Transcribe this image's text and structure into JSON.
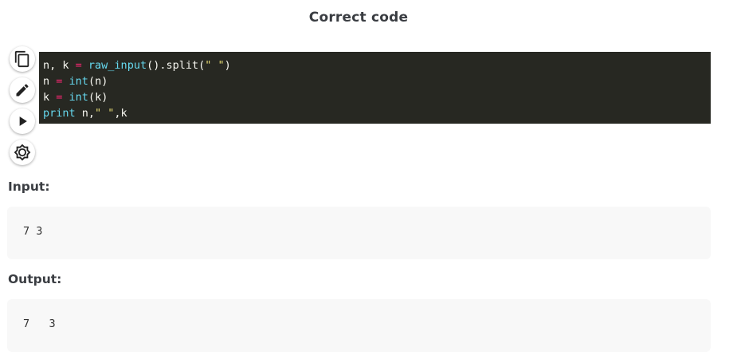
{
  "title": "Correct code",
  "toolbar": {
    "buttons": [
      {
        "name": "copy-button",
        "icon": "copy-icon"
      },
      {
        "name": "edit-button",
        "icon": "pencil-icon"
      },
      {
        "name": "run-button",
        "icon": "play-icon"
      },
      {
        "name": "settings-button",
        "icon": "gear-icon"
      }
    ]
  },
  "code": {
    "lines": [
      [
        {
          "t": "n, k ",
          "c": "plain"
        },
        {
          "t": "=",
          "c": "op"
        },
        {
          "t": " ",
          "c": "plain"
        },
        {
          "t": "raw_input",
          "c": "fn"
        },
        {
          "t": "().split(",
          "c": "plain"
        },
        {
          "t": "\" \"",
          "c": "str"
        },
        {
          "t": ")",
          "c": "plain"
        }
      ],
      [
        {
          "t": "n ",
          "c": "plain"
        },
        {
          "t": "=",
          "c": "op"
        },
        {
          "t": " ",
          "c": "plain"
        },
        {
          "t": "int",
          "c": "fn"
        },
        {
          "t": "(n)",
          "c": "plain"
        }
      ],
      [
        {
          "t": "k ",
          "c": "plain"
        },
        {
          "t": "=",
          "c": "op"
        },
        {
          "t": " ",
          "c": "plain"
        },
        {
          "t": "int",
          "c": "fn"
        },
        {
          "t": "(k)",
          "c": "plain"
        }
      ],
      [
        {
          "t": "print",
          "c": "fn"
        },
        {
          "t": " n,",
          "c": "plain"
        },
        {
          "t": "\" \"",
          "c": "str"
        },
        {
          "t": ",k",
          "c": "plain"
        }
      ]
    ]
  },
  "input": {
    "label": "Input:",
    "value": "7 3"
  },
  "output": {
    "label": "Output:",
    "value": "7   3"
  },
  "colors": {
    "code_bg": "#272822",
    "keyword": "#f92672",
    "builtin": "#66d9ef",
    "string": "#e6db74",
    "io_bg": "#f8f8f8"
  }
}
